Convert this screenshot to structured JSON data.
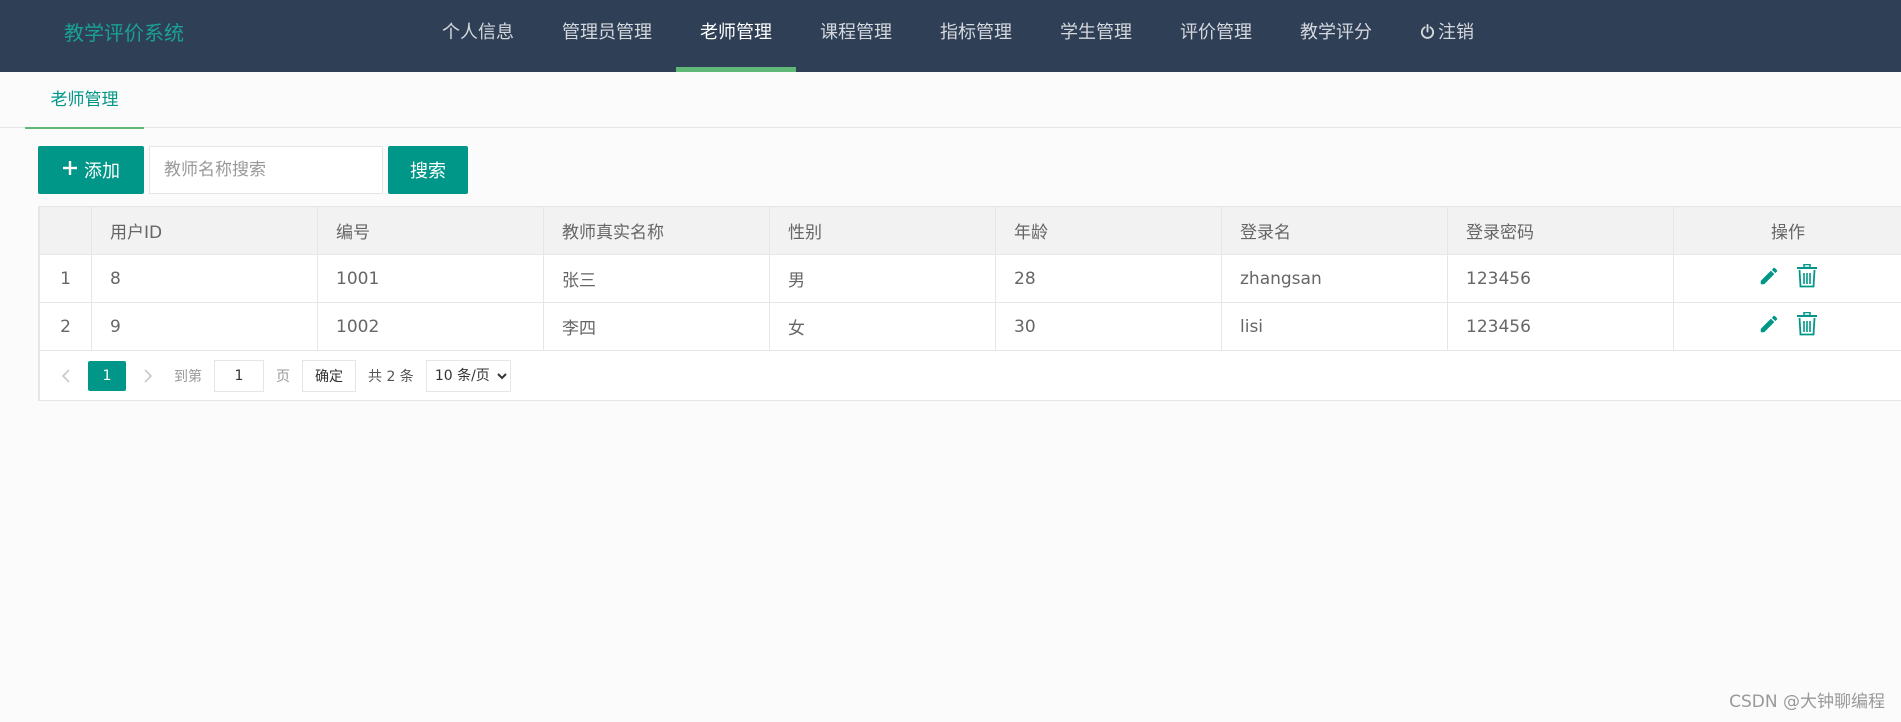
{
  "header": {
    "logo": "教学评价系统",
    "nav": [
      {
        "label": "个人信息"
      },
      {
        "label": "管理员管理"
      },
      {
        "label": "老师管理",
        "active": true
      },
      {
        "label": "课程管理"
      },
      {
        "label": "指标管理"
      },
      {
        "label": "学生管理"
      },
      {
        "label": "评价管理"
      },
      {
        "label": "教学评分"
      },
      {
        "label": "注销",
        "icon": "power-icon"
      }
    ]
  },
  "tab": {
    "label": "老师管理"
  },
  "toolbar": {
    "add_label": "添加",
    "add_icon": "plus-icon",
    "search_placeholder": "教师名称搜索",
    "search_value": "",
    "search_label": "搜索"
  },
  "table": {
    "columns": [
      "",
      "用户ID",
      "编号",
      "教师真实名称",
      "性别",
      "年龄",
      "登录名",
      "登录密码",
      "操作"
    ],
    "rows": [
      {
        "index": "1",
        "user_id": "8",
        "code": "1001",
        "name": "张三",
        "gender": "男",
        "age": "28",
        "login": "zhangsan",
        "password": "123456"
      },
      {
        "index": "2",
        "user_id": "9",
        "code": "1002",
        "name": "李四",
        "gender": "女",
        "age": "30",
        "login": "lisi",
        "password": "123456"
      }
    ],
    "actions": [
      "edit-icon",
      "delete-icon"
    ]
  },
  "pager": {
    "current_page": "1",
    "goto_label": "到第",
    "goto_value": "1",
    "page_unit": "页",
    "confirm_label": "确定",
    "total_label": "共 2 条",
    "page_size_label": "10 条/页"
  },
  "watermark": "CSDN @大钟聊编程",
  "colors": {
    "header_bg": "#2f3f56",
    "accent": "#009688",
    "active_bar": "#5fb878",
    "logo": "#1aa094"
  }
}
